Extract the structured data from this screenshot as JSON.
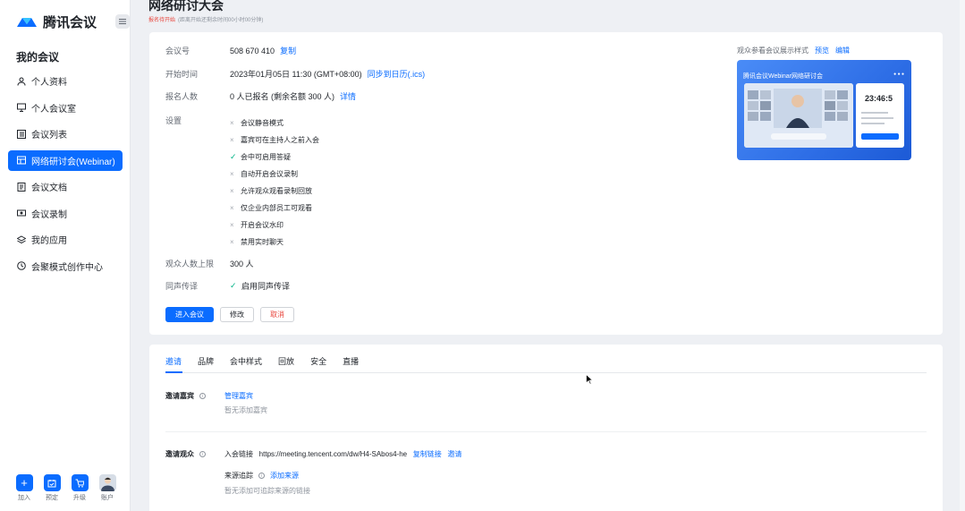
{
  "app": {
    "name": "腾讯会议"
  },
  "sidebar": {
    "section_title": "我的会议",
    "items": [
      {
        "label": "个人资料",
        "icon": "user-icon",
        "active": false
      },
      {
        "label": "个人会议室",
        "icon": "monitor-icon",
        "active": false
      },
      {
        "label": "会议列表",
        "icon": "list-icon",
        "active": false
      },
      {
        "label": "网络研讨会(Webinar)",
        "icon": "webinar-icon",
        "active": true
      },
      {
        "label": "会议文档",
        "icon": "doc-icon",
        "active": false
      },
      {
        "label": "会议录制",
        "icon": "record-icon",
        "active": false
      },
      {
        "label": "我的应用",
        "icon": "apps-icon",
        "active": false
      },
      {
        "label": "会聚模式创作中心",
        "icon": "creator-icon",
        "active": false
      }
    ],
    "bottom": [
      {
        "label": "加入",
        "icon": "plus-icon"
      },
      {
        "label": "预定",
        "icon": "calendar-icon"
      },
      {
        "label": "升级",
        "icon": "cart-icon"
      },
      {
        "label": "账户",
        "icon": "avatar-icon"
      }
    ]
  },
  "header": {
    "title": "网络研讨大会",
    "status": "报名待开始",
    "subtitle": "(距离开始还剩余时间00小时00分钟)"
  },
  "details": {
    "meeting_id_label": "会议号",
    "meeting_id": "508 670 410",
    "copy": "复制",
    "start_label": "开始时间",
    "start_value": "2023年01月05日 11:30 (GMT+08:00)",
    "sync_calendar": "同步到日历(.ics)",
    "signup_label": "报名人数",
    "signup_value": "0 人已报名 (剩余名额 300 人)",
    "signup_link": "详情",
    "settings_label": "设置",
    "settings": [
      {
        "text": "会议静音模式",
        "on": false
      },
      {
        "text": "嘉宾可在主持人之前入会",
        "on": false
      },
      {
        "text": "会中可启用答疑",
        "on": true
      },
      {
        "text": "自动开启会议录制",
        "on": false
      },
      {
        "text": "允许观众观看录制回放",
        "on": false
      },
      {
        "text": "仅企业内部员工可观看",
        "on": false
      },
      {
        "text": "开启会议水印",
        "on": false
      },
      {
        "text": "禁用实时聊天",
        "on": false
      }
    ],
    "capacity_label": "观众人数上限",
    "capacity_value": "300 人",
    "interpret_label": "同声传译",
    "interpret_value": "启用同声传译",
    "btn_enter": "进入会议",
    "btn_edit": "修改",
    "btn_cancel": "取消"
  },
  "preview": {
    "label": "观众参看会议展示样式",
    "preview_link": "预览",
    "edit_link": "编辑",
    "banner_title": "腾讯会议Webinar网络研讨会",
    "countdown": "23:46:5"
  },
  "tabs": [
    "邀请",
    "品牌",
    "会中样式",
    "回放",
    "安全",
    "直播"
  ],
  "invite": {
    "guests_label": "邀请嘉宾",
    "guests_link": "管理嘉宾",
    "guests_empty": "暂无添加嘉宾",
    "audience_label": "邀请观众",
    "join_link_label": "入会链接",
    "join_link": "https://meeting.tencent.com/dw/H4-SAbos4-he",
    "copy_link": "复制链接",
    "invite_link": "邀请",
    "source_label": "来源追踪",
    "add_source": "添加来源",
    "source_empty": "暂无添加可追踪来源的链接"
  },
  "colors": {
    "primary": "#0a6cff",
    "danger": "#e8453c",
    "success": "#00b386"
  }
}
